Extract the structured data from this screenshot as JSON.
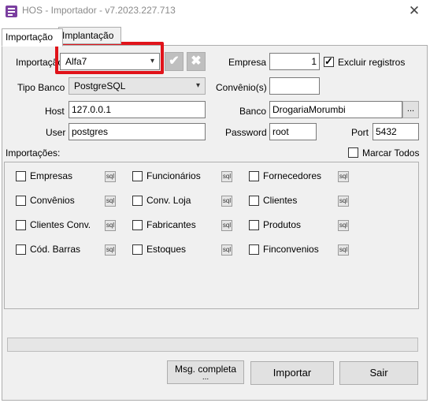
{
  "window": {
    "title": "HOS - Importador - v7.2023.227.713"
  },
  "tabs": [
    {
      "label": "Importação"
    },
    {
      "label": "Implantação"
    }
  ],
  "form": {
    "importacao_label": "Importação",
    "importacao_value": "Alfa7",
    "empresa_label": "Empresa",
    "empresa_value": "1",
    "excluir_label": "Excluir registros",
    "excluir_checked": true,
    "tipo_banco_label": "Tipo Banco",
    "tipo_banco_value": "PostgreSQL",
    "convenios_label": "Convênio(s)",
    "convenios_value": "",
    "host_label": "Host",
    "host_value": "127.0.0.1",
    "banco_label": "Banco",
    "banco_value": "DrogariaMorumbi",
    "browse_label": "...",
    "user_label": "User",
    "user_value": "postgres",
    "password_label": "Password",
    "password_value": "root",
    "port_label": "Port",
    "port_value": "5432"
  },
  "importacoes": {
    "label": "Importações:",
    "marcar_todos": "Marcar Todos",
    "sql_icon_text": "sql",
    "items": [
      {
        "label": "Empresas"
      },
      {
        "label": "Funcionários"
      },
      {
        "label": "Fornecedores"
      },
      {
        "label": "Convênios"
      },
      {
        "label": "Conv. Loja"
      },
      {
        "label": "Clientes"
      },
      {
        "label": "Clientes Conv."
      },
      {
        "label": "Fabricantes"
      },
      {
        "label": "Produtos"
      },
      {
        "label": "Cód. Barras"
      },
      {
        "label": "Estoques"
      },
      {
        "label": "Finconvenios"
      }
    ]
  },
  "buttons": {
    "msg_completa": "Msg. completa",
    "msg_completa_extra": "...",
    "importar": "Importar",
    "sair": "Sair"
  },
  "colors": {
    "highlight": "#e0131a",
    "app_icon": "#7b3fa0"
  }
}
